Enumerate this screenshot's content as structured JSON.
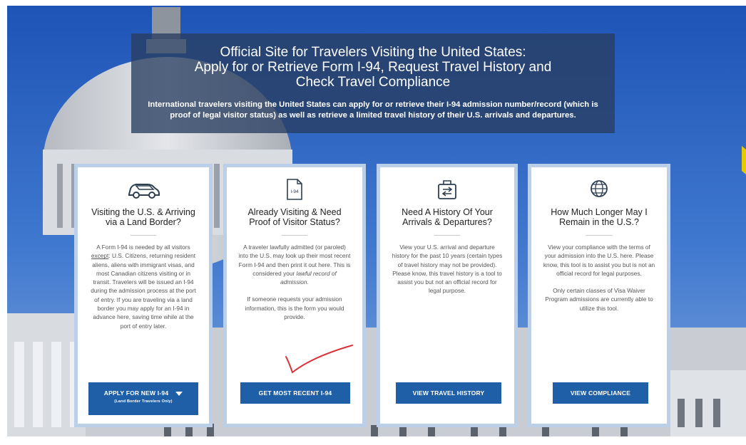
{
  "hero": {
    "title_line1": "Official Site for Travelers Visiting the United States:",
    "title_line2": "Apply for or Retrieve Form I-94, Request Travel History and",
    "title_line3": "Check Travel Compliance",
    "description": "International travelers visiting the United States can apply for or retrieve their I-94 admission number/record (which is proof of legal visitor status) as well as retrieve a limited travel history of their U.S. arrivals and departures."
  },
  "cards": [
    {
      "icon": "car-icon",
      "title_line1": "Visiting the U.S. & Arriving",
      "title_line2": "via a Land Border?",
      "body_pre": "A Form I-94 is needed by all visitors ",
      "body_except": "except",
      "body_mid": ": U.S. Citizens, returning resident aliens, aliens with immigrant visas, and most Canadian citizens visiting or in transit. Travelers will be issued an I-94 during the admission process at the port of entry. If you are traveling via a land border you may apply for an I-94 in advance here, saving time while at the port of entry later.",
      "button_label": "APPLY FOR NEW I-94",
      "button_sub": "(Land Border Travelers Only)"
    },
    {
      "icon": "i94-document-icon",
      "icon_text": "I-94",
      "title_line1": "Already Visiting & Need",
      "title_line2": "Proof of Visitor Status?",
      "body_pre": "A traveler lawfully admitted (or paroled) into the U.S. may look up their most recent Form I-94 and then print it out here. This is considered your ",
      "body_italic": "lawful record of admission",
      "body_post": ".",
      "body_p2": "If someone requests your admission information, this is the form you would provide.",
      "button_label": "GET MOST RECENT I-94"
    },
    {
      "icon": "travel-history-icon",
      "title_line1": "Need A History Of Your",
      "title_line2": "Arrivals & Departures?",
      "body_p1": "View your U.S. arrival and departure history for the past 10 years (certain types of travel history may not be provided). Please know, this travel history is a tool to assist you but not an official record for legal purpose.",
      "button_label": "VIEW TRAVEL HISTORY"
    },
    {
      "icon": "globe-icon",
      "title_line1": "How Much Longer May I",
      "title_line2": "Remain in the U.S.?",
      "body_p1": "View your compliance with the terms of your admission into the U.S. here. Please know, this tool is to assist you but is not an official record for legal purposes.",
      "body_p2": "Only certain classes of Visa Waiver Program admissions are currently able to utilize this tool.",
      "button_label": "VIEW COMPLIANCE"
    }
  ],
  "colors": {
    "button_blue": "#1f5fa8",
    "hero_panel": "#283e60",
    "annotation_check": "#d9333a"
  }
}
